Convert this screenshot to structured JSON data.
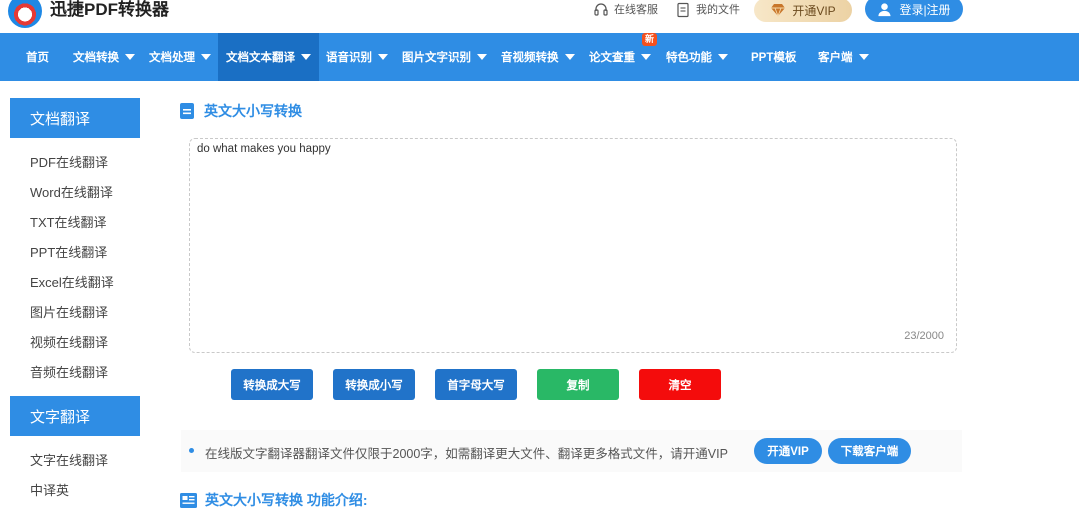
{
  "header": {
    "brand": "迅捷PDF转换器",
    "service_label": "在线客服",
    "files_label": "我的文件",
    "vip_label": "开通VIP",
    "login_label": "登录|注册"
  },
  "nav": {
    "items": [
      {
        "label": "首页"
      },
      {
        "label": "文档转换"
      },
      {
        "label": "文档处理"
      },
      {
        "label": "文档文本翻译"
      },
      {
        "label": "语音识别"
      },
      {
        "label": "图片文字识别"
      },
      {
        "label": "音视频转换"
      },
      {
        "label": "论文查重"
      },
      {
        "label": "特色功能"
      },
      {
        "label": "PPT模板"
      },
      {
        "label": "客户端"
      }
    ],
    "new_badge": "新",
    "active_color": "#1a6fc4",
    "bar_color": "#2f8de4"
  },
  "sidebar": {
    "group1_title": "文档翻译",
    "group1_items": [
      "PDF在线翻译",
      "Word在线翻译",
      "TXT在线翻译",
      "PPT在线翻译",
      "Excel在线翻译",
      "图片在线翻译",
      "视频在线翻译",
      "音频在线翻译"
    ],
    "group2_title": "文字翻译",
    "group2_items": [
      "文字在线翻译",
      "中译英"
    ]
  },
  "main": {
    "title": "英文大小写转换",
    "input_value": "do what makes you happy",
    "counter": "23/2000",
    "buttons": {
      "upper": "转换成大写",
      "lower": "转换成小写",
      "capitalize": "首字母大写",
      "copy": "复制",
      "clear": "清空"
    },
    "notice_text": "在线版文字翻译器翻译文件仅限于2000字，如需翻译更大文件、翻译更多格式文件，请开通VIP",
    "notice_vip": "开通VIP",
    "notice_download": "下载客户端",
    "intro_title": "英文大小写转换 功能介绍:"
  },
  "colors": {
    "accent": "#2f8de4",
    "button_blue": "#2173c9",
    "button_green": "#29b866",
    "button_red": "#f40c0c"
  }
}
